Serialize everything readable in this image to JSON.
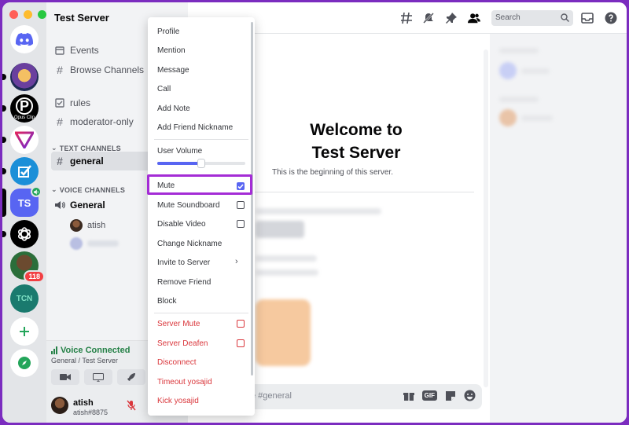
{
  "colors": {
    "background_frame": "#7b2cbf",
    "blurple": "#5865f2",
    "danger": "#da373c",
    "voice_green": "#248046",
    "highlight": "#a42cd6"
  },
  "rail": {
    "servers": [
      {
        "name": "discord-home-icon"
      },
      {
        "name": "server-avatar-1"
      },
      {
        "name": "opus-clip-server",
        "caption": "Opus Clip"
      },
      {
        "name": "server-triangle"
      },
      {
        "name": "server-check"
      },
      {
        "name": "test-server",
        "initials": "TS"
      },
      {
        "name": "chatgpt-server"
      },
      {
        "name": "server-avatar-person",
        "badge": "118"
      },
      {
        "name": "tcn-server",
        "initials": "TCN"
      }
    ]
  },
  "sidebar": {
    "server_name": "Test Server",
    "events_label": "Events",
    "browse_label": "Browse Channels",
    "rules_label": "rules",
    "moderator_label": "moderator-only",
    "text_category": "TEXT CHANNELS",
    "general_label": "general",
    "voice_category": "VOICE CHANNELS",
    "voice_general_label": "General",
    "voice_users": [
      {
        "name": "atish"
      }
    ]
  },
  "voice_panel": {
    "status": "Voice Connected",
    "location": "General / Test Server"
  },
  "user_panel": {
    "username": "atish",
    "tag": "atish#8875"
  },
  "header": {
    "search_placeholder": "Search"
  },
  "chat": {
    "welcome_line1": "Welcome to",
    "welcome_line2": "Test Server",
    "beginning": "This is the beginning of this server.",
    "composer_placeholder": "e #general",
    "gif_label": "GIF"
  },
  "context_menu": {
    "profile": "Profile",
    "mention": "Mention",
    "message": "Message",
    "call": "Call",
    "add_note": "Add Note",
    "add_friend_nickname": "Add Friend Nickname",
    "user_volume": "User Volume",
    "user_volume_level": 0.5,
    "mute": "Mute",
    "mute_checked": true,
    "mute_soundboard": "Mute Soundboard",
    "disable_video": "Disable Video",
    "change_nickname": "Change Nickname",
    "invite_to_server": "Invite to Server",
    "remove_friend": "Remove Friend",
    "block": "Block",
    "server_mute": "Server Mute",
    "server_deafen": "Server Deafen",
    "disconnect": "Disconnect",
    "timeout": "Timeout yosajid",
    "kick": "Kick yosajid"
  }
}
